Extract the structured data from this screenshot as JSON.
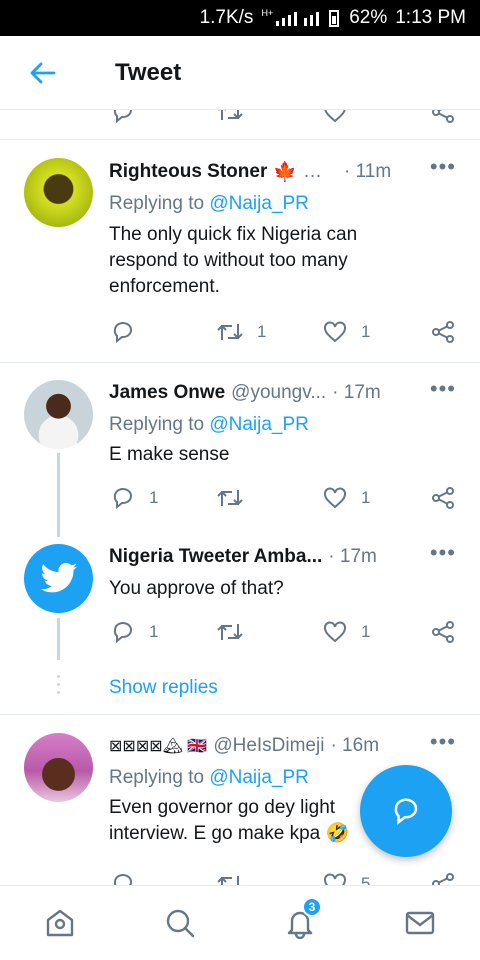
{
  "status_bar": {
    "speed": "1.7K/s",
    "network": "H+",
    "battery": "62%",
    "time": "1:13 PM"
  },
  "header": {
    "title": "Tweet"
  },
  "tweets": [
    {
      "name": "Righteous Stoner",
      "name_emoji": "🍁",
      "handle": "…",
      "time": "· 11m",
      "replying_prefix": "Replying to",
      "replying_to": "@Naija_PR",
      "text": "The only quick fix Nigeria can respond to without too many enforcement.",
      "retweets": "1",
      "likes": "1"
    },
    {
      "name": "James Onwe",
      "handle": "@youngv...",
      "time": "· 17m",
      "replying_prefix": "Replying to",
      "replying_to": "@Naija_PR",
      "text": "E make sense",
      "replies": "1",
      "likes": "1"
    },
    {
      "name": "Nigeria Tweeter Amba...",
      "time": "· 17m",
      "text": "You approve of that?",
      "replies": "1",
      "likes": "1"
    },
    {
      "name": "⊠⊠⊠⊠🏔 🇬🇧",
      "handle": "@HeIsDimeji",
      "time": "· 16m",
      "replying_prefix": "Replying to",
      "replying_to": "@Naija_PR",
      "text": "Even governor go dey light interview. E go make kpa 🤣",
      "likes": "5"
    }
  ],
  "show_replies": "Show replies",
  "bottom_nav": {
    "notifications_badge": "3"
  },
  "colors": {
    "accent": "#1da1f2",
    "secondary_text": "#657786",
    "divider": "#e6ecf0"
  },
  "icons": [
    "arrow-left-icon",
    "reply-icon",
    "retweet-icon",
    "heart-icon",
    "share-icon",
    "more-icon",
    "home-icon",
    "search-icon",
    "bell-icon",
    "mail-icon",
    "compose-reply-icon",
    "twitter-bird-icon"
  ]
}
